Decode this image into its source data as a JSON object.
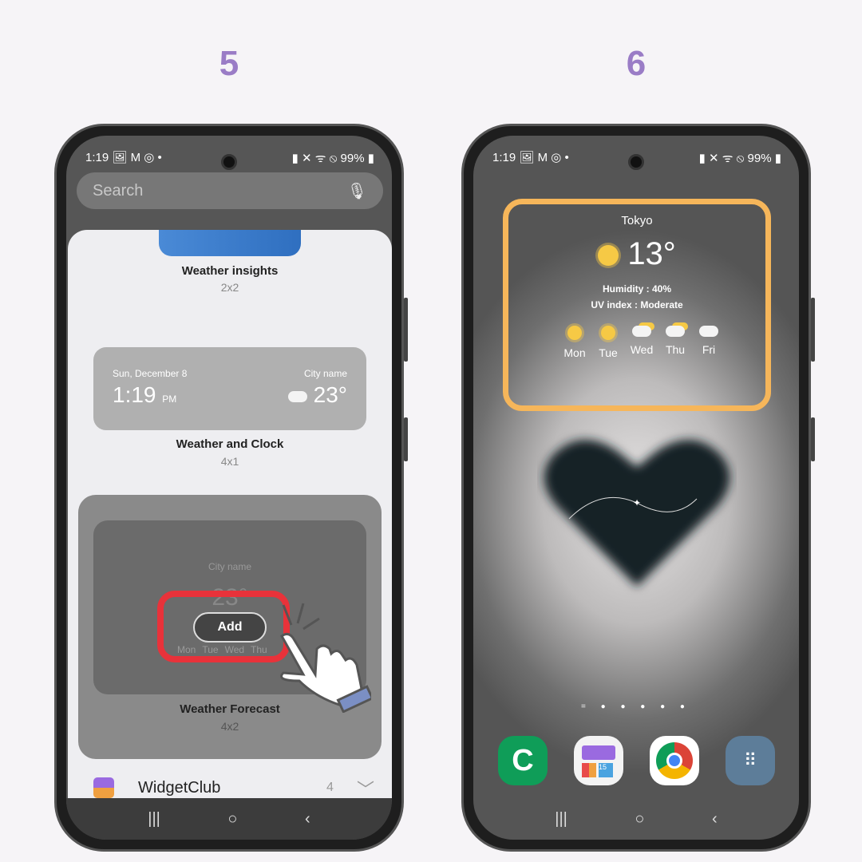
{
  "steps": [
    "5",
    "6"
  ],
  "status": {
    "time": "1:19",
    "icons_left": "🖼 M ◎ •",
    "battery": "99%"
  },
  "left": {
    "search_placeholder": "Search",
    "widgets": [
      {
        "name": "Weather insights",
        "size": "2x2"
      },
      {
        "name": "Weather and Clock",
        "size": "4x1",
        "date": "Sun, December 8",
        "time": "1:19",
        "ampm": "PM",
        "city": "City name",
        "temp": "23°"
      },
      {
        "name": "Weather Forecast",
        "size": "4x2",
        "city": "City name",
        "temp": "23°",
        "days": [
          "Mon",
          "Tue",
          "Wed",
          "Thu"
        ],
        "add_label": "Add"
      }
    ],
    "app_row": {
      "name": "WidgetClub",
      "count": "4"
    }
  },
  "right": {
    "widget": {
      "city": "Tokyo",
      "temp": "13°",
      "humidity": "Humidity : 40%",
      "uv": "UV index : Moderate",
      "days": [
        {
          "d": "Mon",
          "icon": "sun"
        },
        {
          "d": "Tue",
          "icon": "sun"
        },
        {
          "d": "Wed",
          "icon": "partly-cloudy"
        },
        {
          "d": "Thu",
          "icon": "partly-cloudy"
        },
        {
          "d": "Fri",
          "icon": "cloud"
        }
      ]
    },
    "dock": [
      "phone",
      "widgetclub",
      "chrome",
      "apps"
    ],
    "dock_badge": "15"
  },
  "nav": {
    "recents": "|||",
    "home": "○",
    "back": "‹"
  },
  "colors": {
    "step": "#9a7cc6",
    "highlight_red": "#e8323a",
    "widget_border": "#f6b65a"
  }
}
